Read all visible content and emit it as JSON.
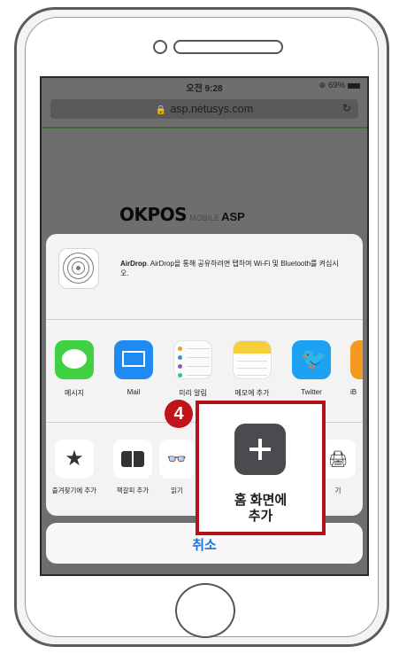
{
  "status": {
    "time": "오전 9:28",
    "battery": "69%"
  },
  "browser": {
    "url": "asp.netusys.com"
  },
  "page": {
    "logo_main": "OKPOS",
    "logo_sub": "MOBILE",
    "logo_asp": "ASP"
  },
  "airdrop": {
    "title": "AirDrop",
    "text": ". AirDrop을 통해 공유하려면 탭하여 Wi-Fi 및 Bluetooth를 켜십시오."
  },
  "share_apps": [
    {
      "label": "메시지",
      "icon": "messages-icon"
    },
    {
      "label": "Mail",
      "icon": "mail-icon"
    },
    {
      "label": "미리 알림",
      "icon": "reminders-icon"
    },
    {
      "label": "메모에 추가",
      "icon": "notes-icon"
    },
    {
      "label": "Twitter",
      "icon": "twitter-icon"
    },
    {
      "label": "iB",
      "icon": "ibooks-icon"
    }
  ],
  "actions": [
    {
      "label": "즐겨찾기에 추가",
      "icon": "star-icon"
    },
    {
      "label": "책갈피 추가",
      "icon": "bookmark-icon"
    },
    {
      "label": "읽기",
      "icon": "reading-list-icon"
    },
    {
      "label": "기",
      "icon": "print-icon"
    }
  ],
  "cancel_label": "취소",
  "callout": {
    "step": "4",
    "label": "홈 화면에\n추가"
  },
  "colors": {
    "highlight": "#b0141a",
    "link_blue": "#1f73e8"
  }
}
